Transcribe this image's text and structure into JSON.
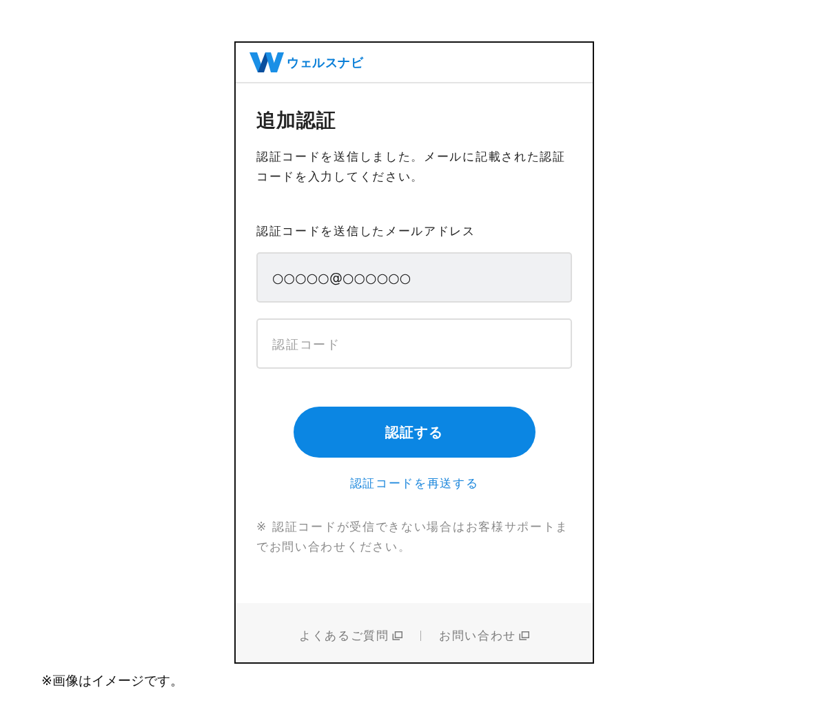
{
  "header": {
    "brand_name": "ウェルスナビ"
  },
  "title": "追加認証",
  "description": "認証コードを送信しました。メールに記載された認証コードを入力してください。",
  "email_field": {
    "label": "認証コードを送信したメールアドレス",
    "value": "○○○○○@○○○○○○",
    "disabled": true
  },
  "code_field": {
    "placeholder": "認証コード"
  },
  "submit_button": "認証する",
  "resend_link": "認証コードを再送する",
  "note": "※ 認証コードが受信できない場合はお客様サポートまでお問い合わせください。",
  "footer": {
    "links": [
      {
        "label": "よくあるご質問"
      },
      {
        "label": "お問い合わせ"
      }
    ]
  },
  "caption": "※画像はイメージです。"
}
